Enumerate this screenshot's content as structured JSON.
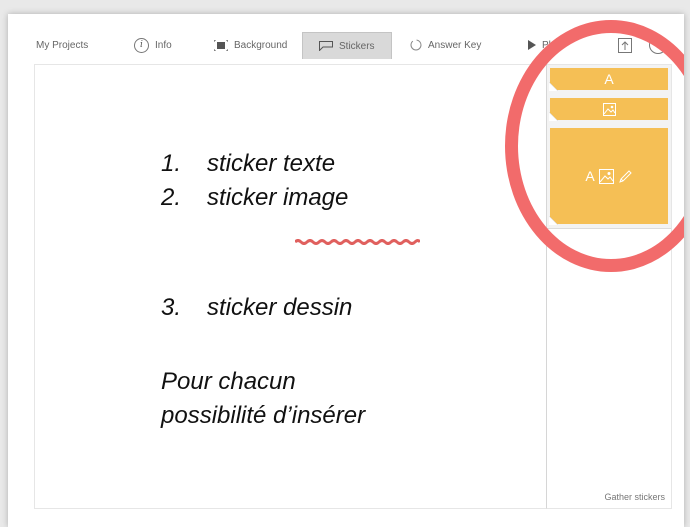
{
  "toolbar": {
    "my_projects": "My Projects",
    "info": "Info",
    "background": "Background",
    "stickers": "Stickers",
    "answer_key": "Answer Key",
    "play": "Play",
    "info_icon_glyph": "i",
    "help_icon_glyph": "?"
  },
  "sidebar": {
    "sticker_text": "A",
    "sticker_image": "",
    "sticker_draw": "A",
    "gather_label": "Gather stickers"
  },
  "annotations": {
    "item1_num": "1.",
    "item1_text": "sticker texte",
    "item2_num": "2.",
    "item2_text": "sticker image",
    "item3_num": "3.",
    "item3_text": "sticker dessin",
    "note_line1": "Pour chacun",
    "note_line2": "possibilité d’insérer"
  },
  "colors": {
    "sticker": "#f5bf55",
    "highlight": "#f26b6b",
    "squiggle": "#e0605e"
  }
}
